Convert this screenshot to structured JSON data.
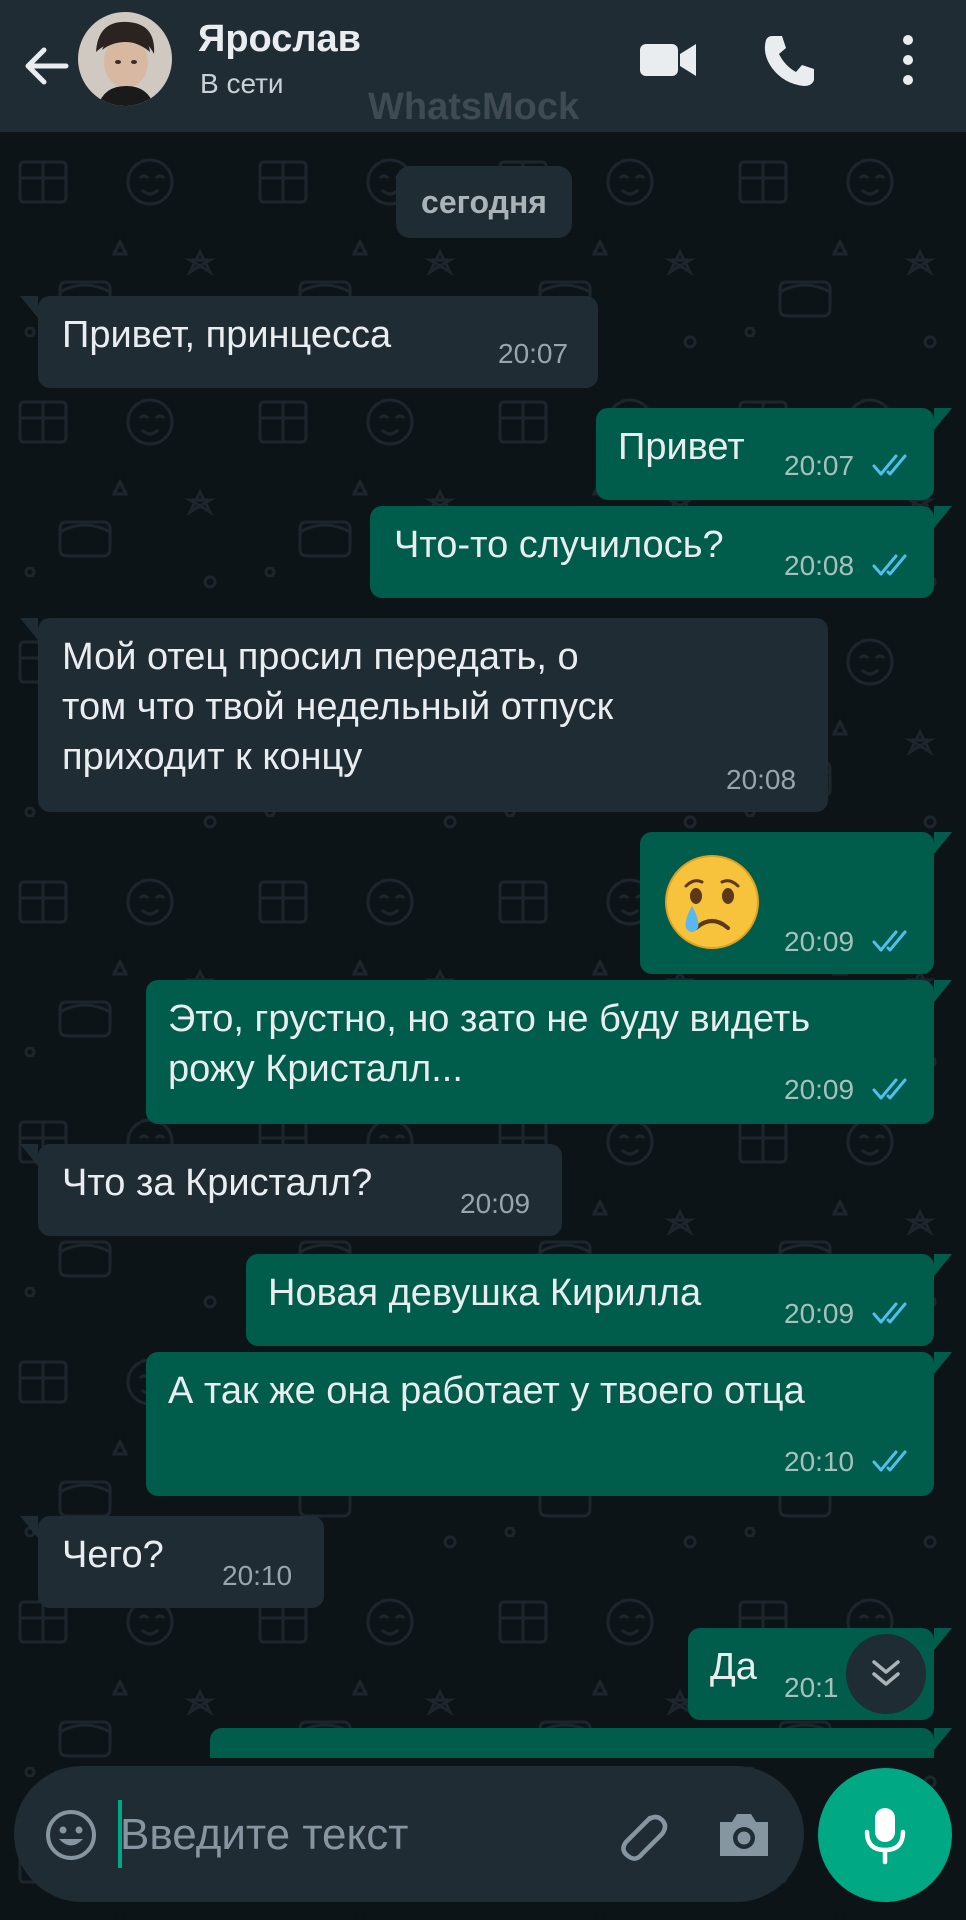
{
  "header": {
    "contact_name": "Ярослав",
    "status": "В сети",
    "watermark": "WhatsMock"
  },
  "chat": {
    "date_label": "сегодня",
    "messages": [
      {
        "direction": "in",
        "text": "Привет, принцесса",
        "time": "20:07"
      },
      {
        "direction": "out",
        "text": "Привет",
        "time": "20:07",
        "read": true
      },
      {
        "direction": "out",
        "text": "Что-то случилось?",
        "time": "20:08",
        "read": true
      },
      {
        "direction": "in",
        "text": "Мой отец просил передать, о\nтом что твой недельный отпуск\nприходит к концу",
        "time": "20:08"
      },
      {
        "direction": "out",
        "text": "",
        "emoji": "crying-face",
        "time": "20:09",
        "read": true
      },
      {
        "direction": "out",
        "text": "Это, грустно, но зато не буду видеть\nрожу Кристалл...",
        "time": "20:09",
        "read": true
      },
      {
        "direction": "in",
        "text": "Что за Кристалл?",
        "time": "20:09"
      },
      {
        "direction": "out",
        "text": "Новая девушка Кирилла",
        "time": "20:09",
        "read": true
      },
      {
        "direction": "out",
        "text": "А так же она работает у твоего отца",
        "time": "20:10",
        "read": true
      },
      {
        "direction": "in",
        "text": "Чего?",
        "time": "20:10"
      },
      {
        "direction": "out",
        "text": "Да",
        "time": "20:1",
        "read": true
      }
    ]
  },
  "composer": {
    "placeholder": "Введите текст"
  },
  "colors": {
    "header_bg": "#1f2c34",
    "incoming_bubble": "#1f2c34",
    "outgoing_bubble": "#005c4b",
    "accent": "#00a884",
    "read_ticks": "#53bdeb"
  }
}
